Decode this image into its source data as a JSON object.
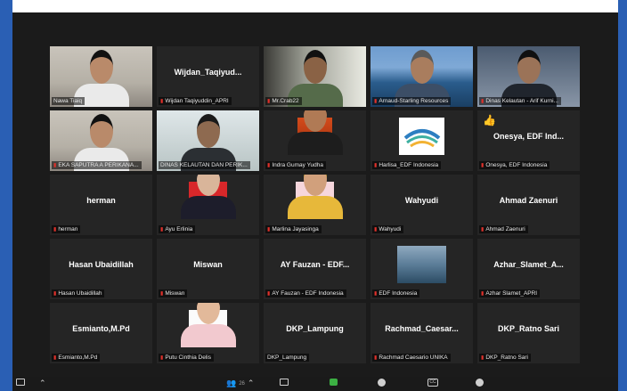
{
  "meeting": {
    "tiles": [
      {
        "display": "",
        "label": "Nawa Tiaiq",
        "scene": "office",
        "muted": false
      },
      {
        "display": "Wijdan_Taqiyud...",
        "label": "Wijdan Taqiyuddin_APRI",
        "scene": "",
        "muted": true
      },
      {
        "display": "",
        "label": "Mr.Crab22",
        "scene": "wall",
        "muted": true
      },
      {
        "display": "",
        "label": "Arnaud-Starling Resources",
        "scene": "sea",
        "muted": true
      },
      {
        "display": "",
        "label": "Dinas Kelautan - Arif Kurni...",
        "scene": "room",
        "muted": true
      },
      {
        "display": "",
        "label": "EKA SAPUTRA A PERIKANA...",
        "scene": "office",
        "muted": true
      },
      {
        "display": "",
        "label": "DINAS KELAUTAN DAN PERIK...",
        "scene": "window",
        "muted": false,
        "active": true
      },
      {
        "display": "",
        "label": "Indra Gumay Yudha",
        "scene": "orange",
        "muted": true
      },
      {
        "display": "",
        "label": "Harlisa_EDF Indonesia",
        "scene": "logo",
        "muted": true
      },
      {
        "display": "Onesya, EDF Ind...",
        "label": "Onesya, EDF Indonesia",
        "scene": "",
        "muted": true,
        "hand": true
      },
      {
        "display": "herman",
        "label": "herman",
        "scene": "",
        "muted": true
      },
      {
        "display": "",
        "label": "Ayu Erlinia",
        "scene": "photo-red",
        "muted": true
      },
      {
        "display": "",
        "label": "Marlina Jayasinga",
        "scene": "photo-pink",
        "muted": true
      },
      {
        "display": "Wahyudi",
        "label": "Wahyudi",
        "scene": "",
        "muted": true
      },
      {
        "display": "Ahmad Zaenuri",
        "label": "Ahmad Zaenuri",
        "scene": "",
        "muted": true
      },
      {
        "display": "Hasan Ubaidillah",
        "label": "Hasan Ubaidillah",
        "scene": "",
        "muted": true
      },
      {
        "display": "Miswan",
        "label": "Miswan",
        "scene": "",
        "muted": true
      },
      {
        "display": "AY Fauzan - EDF...",
        "label": "AY Fauzan - EDF Indonesia",
        "scene": "",
        "muted": true
      },
      {
        "display": "",
        "label": "EDF Indonesia",
        "scene": "harbor",
        "muted": true
      },
      {
        "display": "Azhar_Slamet_A...",
        "label": "Azhar Slamet_APRI",
        "scene": "",
        "muted": true
      },
      {
        "display": "Esmianto,M.Pd",
        "label": "Esmianto,M.Pd",
        "scene": "",
        "muted": true
      },
      {
        "display": "",
        "label": "Putu Cinthia Delis",
        "scene": "photo-white",
        "muted": true
      },
      {
        "display": "DKP_Lampung",
        "label": "DKP_Lampung",
        "scene": "",
        "muted": false
      },
      {
        "display": "Rachmad_Caesar...",
        "label": "Rachmad Caesario UNIKA",
        "scene": "",
        "muted": true
      },
      {
        "display": "DKP_Ratno Sari",
        "label": "DKP_Ratno Sari",
        "scene": "",
        "muted": true
      }
    ]
  },
  "toolbar": {
    "participants_count": "26"
  },
  "colors": {
    "frame_blue": "#2a5fb4",
    "window_bg": "#1b1b1b",
    "tile_bg": "#252525",
    "active_speaker": "#d8e04a",
    "mic_muted": "#e0312a"
  }
}
